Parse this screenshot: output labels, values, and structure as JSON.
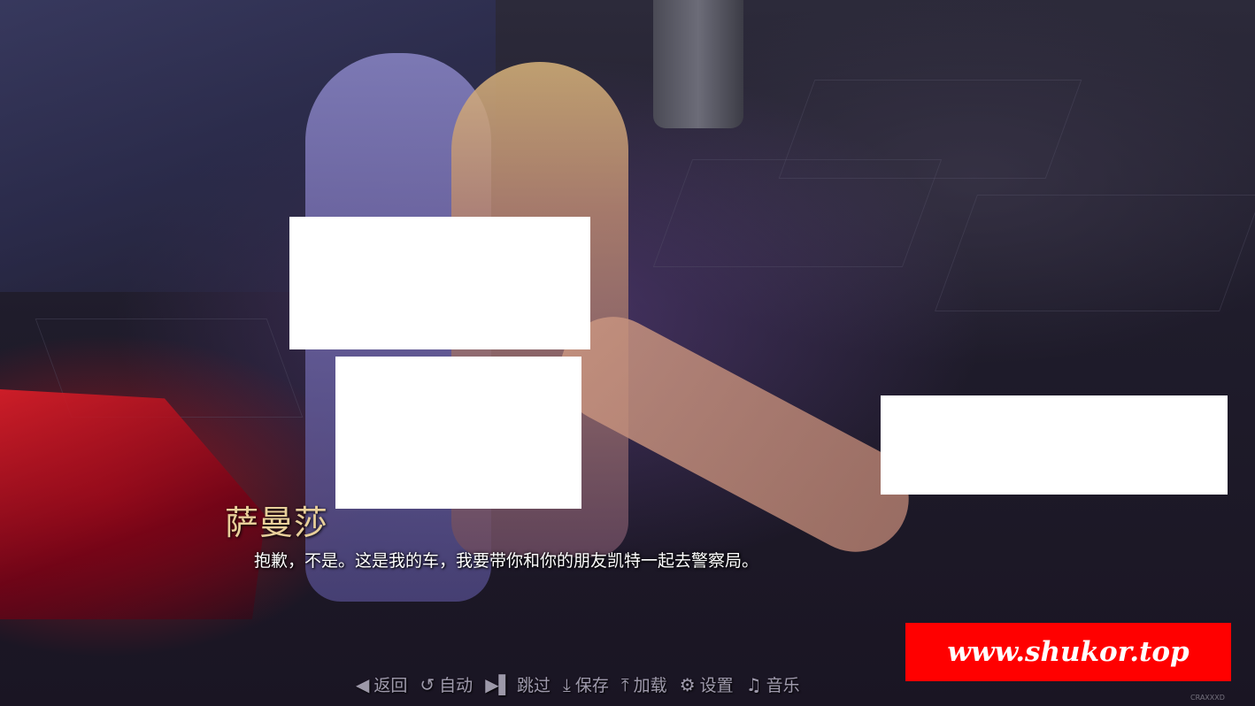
{
  "dialogue": {
    "speaker": "萨曼莎",
    "text": "抱歉，不是。这是我的车，我要带你和你的朋友凯特一起去警察局。"
  },
  "quick_menu": [
    {
      "icon": "◀",
      "label": "返回"
    },
    {
      "icon": "↺",
      "label": "自动"
    },
    {
      "icon": "▶▌",
      "label": "跳过"
    },
    {
      "icon": "⤓",
      "label": "保存"
    },
    {
      "icon": "⤒",
      "label": "加载"
    },
    {
      "icon": "⚙",
      "label": "设置"
    },
    {
      "icon": "♫",
      "label": "音乐"
    }
  ],
  "watermark": "www.shukor.top",
  "credit": "CRAXXXD",
  "colors": {
    "speaker_name": "#e8cf9a",
    "dialogue_text": "#ffffff",
    "menu_text": "#c8c3d7",
    "watermark_bg": "#ff0000"
  }
}
